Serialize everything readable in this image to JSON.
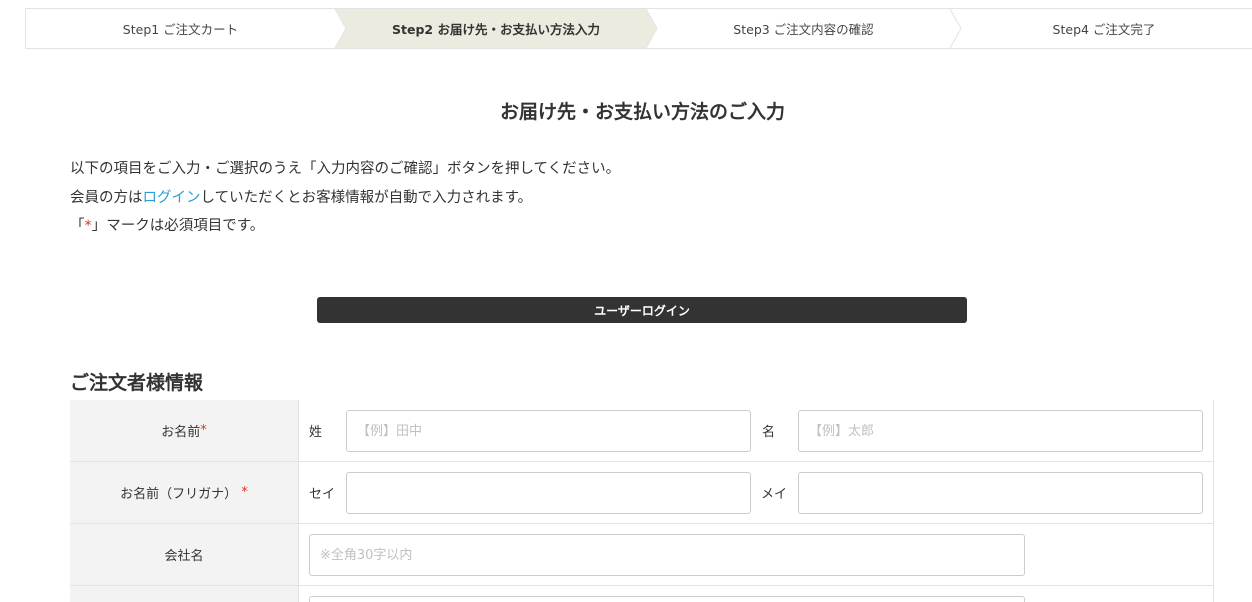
{
  "steps": [
    {
      "label": "Step1 ご注文カート"
    },
    {
      "label": "Step2 お届け先・お支払い方法入力"
    },
    {
      "label": "Step3 ご注文内容の確認"
    },
    {
      "label": "Step4 ご注文完了"
    }
  ],
  "colors": {
    "active_step_bg": "#ecebdf",
    "link": "#2a9fd6",
    "required": "#d9342b",
    "button_bg": "#333333"
  },
  "page_title": "お届け先・お支払い方法のご入力",
  "intro": {
    "line1": "以下の項目をご入力・ご選択のうえ「入力内容のご確認」ボタンを押してください。",
    "line2_pre": "会員の方は",
    "line2_link": "ログイン",
    "line2_post": "していただくとお客様情報が自動で入力されます。",
    "line3_pre": "「",
    "line3_mark": "*",
    "line3_post": "」マークは必須項目です。"
  },
  "login_button": "ユーザーログイン",
  "section_title": "ご注文者様情報",
  "form": {
    "name": {
      "label": "お名前",
      "required_mark": "*",
      "last_label": "姓",
      "last_placeholder": "【例】田中",
      "first_label": "名",
      "first_placeholder": "【例】太郎"
    },
    "kana": {
      "label": "お名前（フリガナ）",
      "required_mark": "*",
      "last_label": "セイ",
      "last_value": "",
      "first_label": "メイ",
      "first_value": ""
    },
    "company": {
      "label": "会社名",
      "placeholder": "※全角30字以内"
    }
  }
}
